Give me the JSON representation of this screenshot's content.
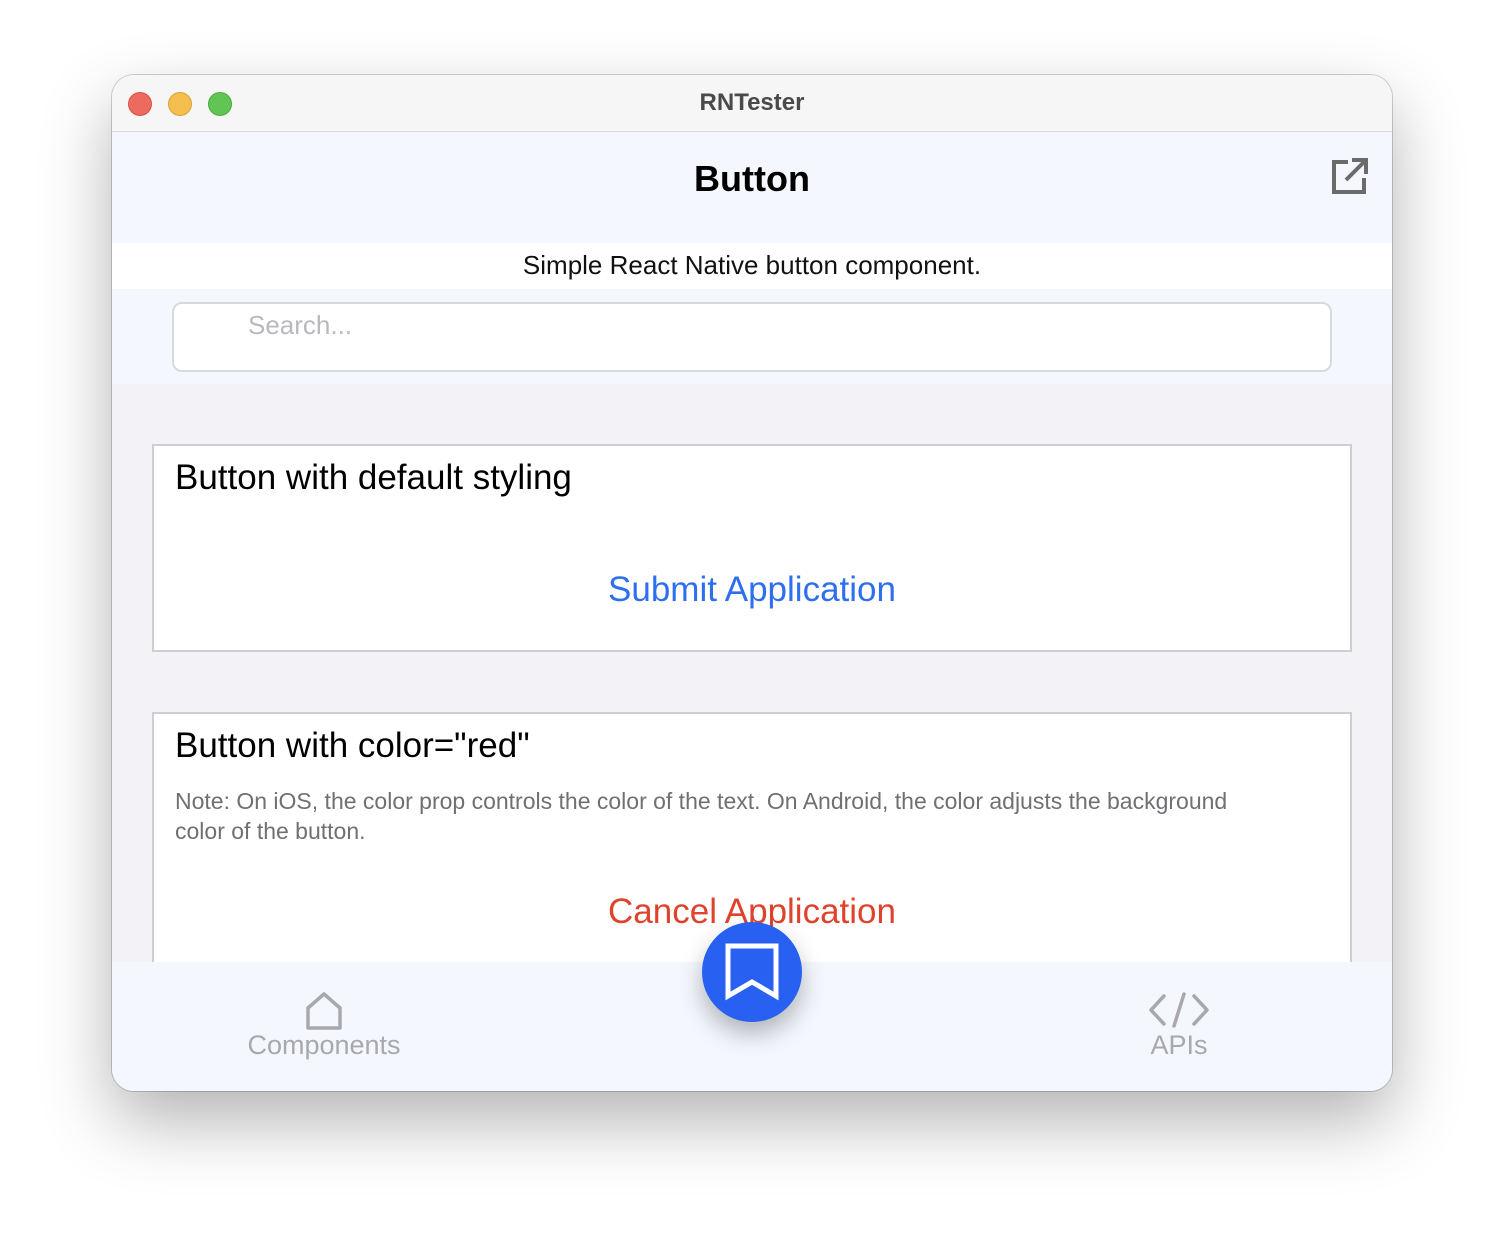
{
  "window": {
    "title": "RNTester"
  },
  "navbar": {
    "title": "Button",
    "external_icon": "open-external-icon"
  },
  "description": "Simple React Native button component.",
  "search": {
    "placeholder": "Search...",
    "value": ""
  },
  "examples": [
    {
      "title": "Button with default styling",
      "note": "",
      "button_label": "Submit Application",
      "button_color": "#2e6ff0"
    },
    {
      "title": "Button with color=\"red\"",
      "note": "Note: On iOS, the color prop controls the color of the text. On Android, the color adjusts the background color of the button.",
      "button_label": "Cancel Application",
      "button_color": "#e0432c"
    }
  ],
  "tabbar": {
    "tabs": [
      {
        "label": "Components",
        "icon": "home-icon"
      },
      {
        "label": "APIs",
        "icon": "code-icon"
      }
    ],
    "fab_icon": "bookmark-icon",
    "fab_color": "#2860f2"
  }
}
